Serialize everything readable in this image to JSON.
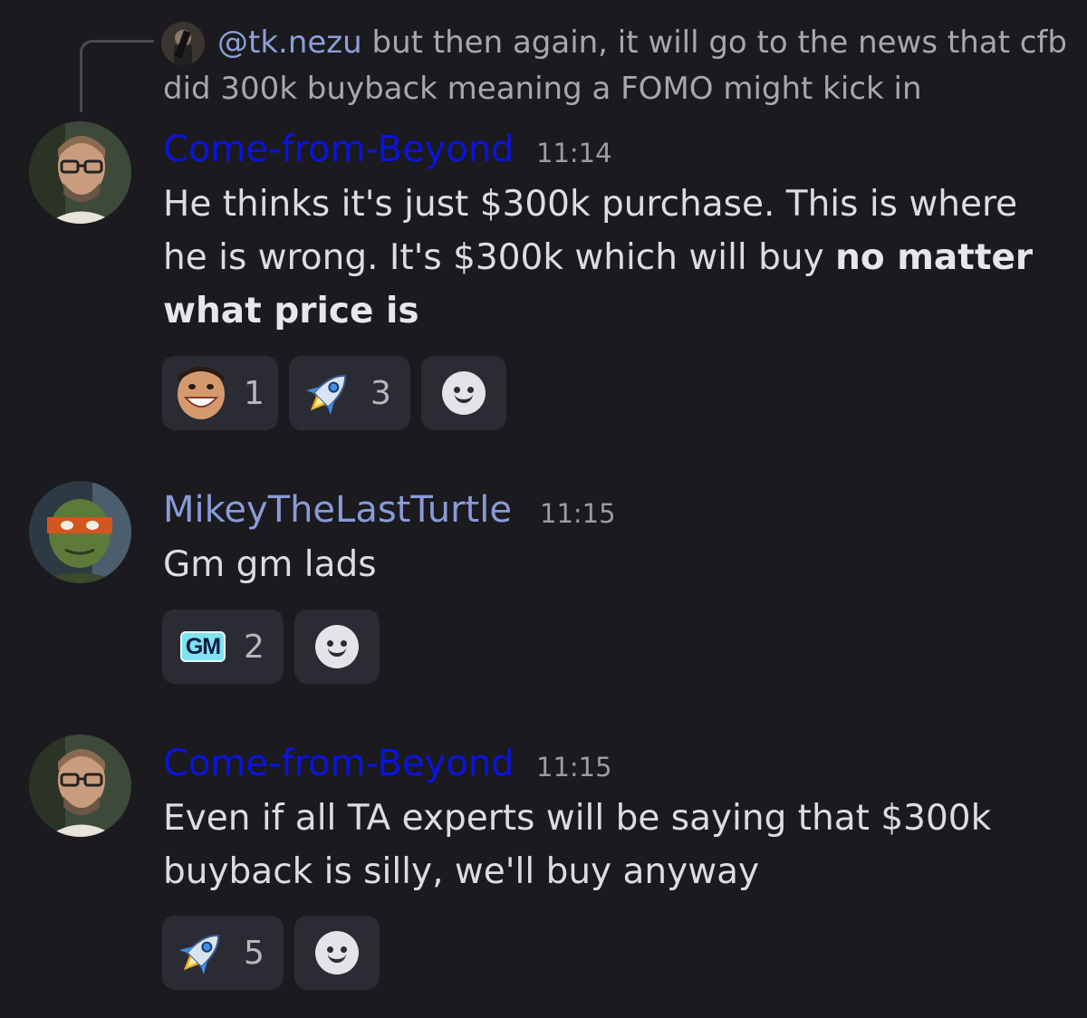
{
  "reply": {
    "username": "@tk.nezu",
    "text": "but then again, it will go to the news that cfb did 300k buyback meaning a FOMO might kick in"
  },
  "messages": [
    {
      "username": "Come-from-Beyond",
      "time": "11:14",
      "text_plain": "He thinks it's just $300k purchase. This is where he is wrong. It's $300k which will buy ",
      "text_bold": "no matter what price is",
      "reactions": [
        {
          "emoji": "face-emoji",
          "count": "1"
        },
        {
          "emoji": "rocket-emoji",
          "count": "3"
        }
      ]
    },
    {
      "username": "MikeyTheLastTurtle",
      "time": "11:15",
      "text": "Gm gm lads",
      "reactions": [
        {
          "emoji": "gm-emoji",
          "label": "GM",
          "count": "2"
        }
      ]
    },
    {
      "username": "Come-from-Beyond",
      "time": "11:15",
      "text": "Even if all TA experts will be saying that $300k buyback is silly, we'll buy anyway",
      "reactions": [
        {
          "emoji": "rocket-emoji",
          "count": "5"
        }
      ]
    }
  ],
  "colors": {
    "background": "#1a1a1f",
    "cfb_name": "#0a14dc",
    "mikey_name": "#8a9ad6",
    "reply_mention": "#8c9fd8",
    "reaction_bg": "#2b2c33"
  }
}
